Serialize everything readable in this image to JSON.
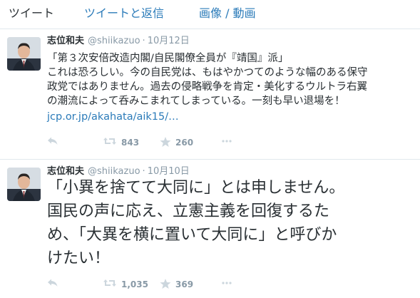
{
  "tabs": [
    {
      "label": "ツイート"
    },
    {
      "label": "ツイートと返信"
    },
    {
      "label": "画像 / 動画"
    }
  ],
  "colors": {
    "link": "#2b7bb9",
    "text": "#292f33",
    "meta": "#8899a6",
    "border": "#e1e8ed"
  },
  "tweets": [
    {
      "name": "志位和夫",
      "handle": "@shiikazuo",
      "separator": "·",
      "date": "10月12日",
      "lines": [
        "「第３次安倍改造内閣/自民閣僚全員が『靖国』派」",
        "これは恐ろしい。今の自民党は、もはやかつてのような幅のある保守",
        "政党ではありません。過去の侵略戦争を肯定・美化するウルトラ右翼",
        "の潮流によって呑みこまれてしまっている。一刻も早い退場を！"
      ],
      "link": "jcp.or.jp/akahata/aik15/…",
      "retweets": "843",
      "favorites": "260"
    },
    {
      "name": "志位和夫",
      "handle": "@shiikazuo",
      "separator": "·",
      "date": "10月10日",
      "lines": [
        "「小異を捨てて大同に」とは申しません。",
        "国民の声に応え、立憲主義を回復するた",
        "め、「大異を横に置いて大同に」と呼びか",
        "けたい！"
      ],
      "retweets": "1,035",
      "favorites": "369"
    }
  ],
  "icons": [
    "reply-icon",
    "retweet-icon",
    "favorite-star-icon",
    "more-dots-icon"
  ]
}
